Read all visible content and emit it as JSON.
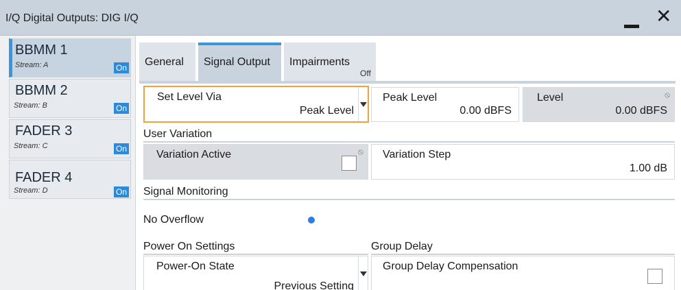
{
  "window": {
    "title": "I/Q Digital Outputs: DIG I/Q"
  },
  "sidebar": {
    "items": [
      {
        "name": "BBMM 1",
        "stream": "Stream: A",
        "state": "On"
      },
      {
        "name": "BBMM 2",
        "stream": "Stream: B",
        "state": "On"
      },
      {
        "name": "FADER 3",
        "stream": "Stream: C",
        "state": "On"
      },
      {
        "name": "FADER 4",
        "stream": "Stream: D",
        "state": "On"
      }
    ]
  },
  "tabs": [
    {
      "label": "General"
    },
    {
      "label": "Signal Output"
    },
    {
      "label": "Impairments",
      "badge": "Off"
    }
  ],
  "level": {
    "set_level_via_label": "Set Level Via",
    "set_level_via_value": "Peak Level",
    "peak_level_label": "Peak Level",
    "peak_level_value": "0.00 dBFS",
    "level_label": "Level",
    "level_value": "0.00 dBFS"
  },
  "user_variation": {
    "section": "User Variation",
    "variation_active_label": "Variation Active",
    "variation_step_label": "Variation Step",
    "variation_step_value": "1.00 dB"
  },
  "signal_monitoring": {
    "section": "Signal Monitoring",
    "status": "No Overflow"
  },
  "power_on": {
    "section": "Power On Settings",
    "state_label": "Power-On State",
    "state_value": "Previous Setting"
  },
  "group_delay": {
    "section": "Group Delay",
    "compensation_label": "Group Delay Compensation"
  },
  "colors": {
    "accent": "#3b95da",
    "focus": "#f2a038",
    "led": "#2c7fdc"
  }
}
